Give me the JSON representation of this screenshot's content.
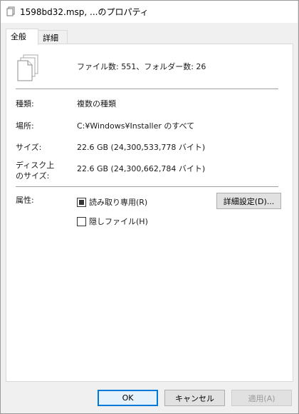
{
  "window": {
    "title": "1598bd32.msp, ...のプロパティ"
  },
  "tabs": [
    {
      "label": "全般",
      "active": true
    },
    {
      "label": "詳細",
      "active": false
    }
  ],
  "summary": {
    "file_count_text": "ファイル数: 551、フォルダー数: 26"
  },
  "properties": {
    "type_label": "種類:",
    "type_value": "複数の種類",
    "location_label": "場所:",
    "location_value": "C:¥Windows¥Installer のすべて",
    "size_label": "サイズ:",
    "size_value": "22.6 GB (24,300,533,778 バイト)",
    "disk_size_label_line1": "ディスク上",
    "disk_size_label_line2": "のサイズ:",
    "disk_size_value": "22.6 GB (24,300,662,784 バイト)",
    "attributes_label": "属性:"
  },
  "attributes": {
    "readonly_label": "読み取り専用(R)",
    "readonly_state": "indeterminate",
    "hidden_label": "隠しファイル(H)",
    "hidden_state": "unchecked",
    "advanced_button": "詳細設定(D)..."
  },
  "footer": {
    "ok": "OK",
    "cancel": "キャンセル",
    "apply": "適用(A)"
  },
  "colors": {
    "accent": "#0078d7"
  }
}
